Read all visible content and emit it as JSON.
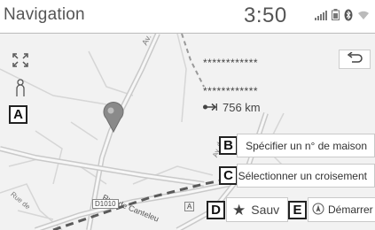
{
  "header": {
    "title": "Navigation",
    "clock": "3:50"
  },
  "icons": {
    "signal": "signal-bars-icon",
    "battery": "battery-icon",
    "bluetooth": "bluetooth-icon",
    "wifi": "wifi-icon",
    "expand": "expand-map-icon",
    "person": "pedestrian-icon",
    "pin": "location-pin-icon",
    "back": "return-arrow-icon",
    "distance": "distance-arrow-icon",
    "star": "star-icon",
    "compass": "start-navigation-icon"
  },
  "map": {
    "street_labels": [
      "Av. G",
      "Rue de Canteleu",
      "D1010",
      "A",
      "Rue de",
      "Av. d"
    ]
  },
  "destination": {
    "line1": "************",
    "line2": "************",
    "distance": "756 km"
  },
  "actions": {
    "house_number": "Spécifier un n° de maison",
    "intersection": "Sélectionner un croisement",
    "save": "Sauv",
    "start": "Démarrer"
  },
  "callouts": {
    "a": "A",
    "b": "B",
    "c": "C",
    "d": "D",
    "e": "E"
  },
  "colors": {
    "map_background": "#f2f2f2",
    "road": "#cfcfcf",
    "route_dash": "#5a5a5a",
    "pin": "#8a8a8a"
  }
}
